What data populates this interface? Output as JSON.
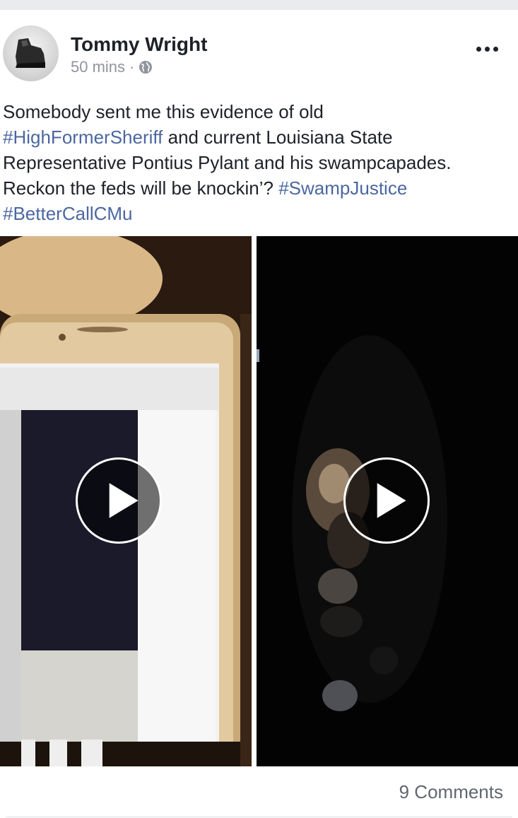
{
  "post": {
    "author": "Tommy Wright",
    "time": "50 mins",
    "separator": "·",
    "privacy_icon": "globe-icon",
    "more_icon": "more-horizontal-icon",
    "text_lines": [
      [
        {
          "t": "Somebody sent me this evidence of old",
          "tag": false
        }
      ],
      [
        {
          "t": "#HighFormerSheriff",
          "tag": true
        },
        {
          "t": " and current Louisiana State",
          "tag": false
        }
      ],
      [
        {
          "t": "Representative Pontius Pylant and his swampcapades.",
          "tag": false
        }
      ],
      [
        {
          "t": "Reckon the feds will be knockin’? ",
          "tag": false
        },
        {
          "t": "#SwampJustice",
          "tag": true
        }
      ],
      [
        {
          "t": "#BetterCallCMu",
          "tag": true
        }
      ]
    ],
    "videos": [
      {
        "name": "video-left",
        "icon": "play-icon"
      },
      {
        "name": "video-right",
        "icon": "play-icon"
      }
    ],
    "comments_label": "9 Comments"
  },
  "colors": {
    "hashtag": "#4b67a1",
    "text": "#1d2129",
    "meta": "#90949c",
    "page_band": "#e9ebee"
  }
}
